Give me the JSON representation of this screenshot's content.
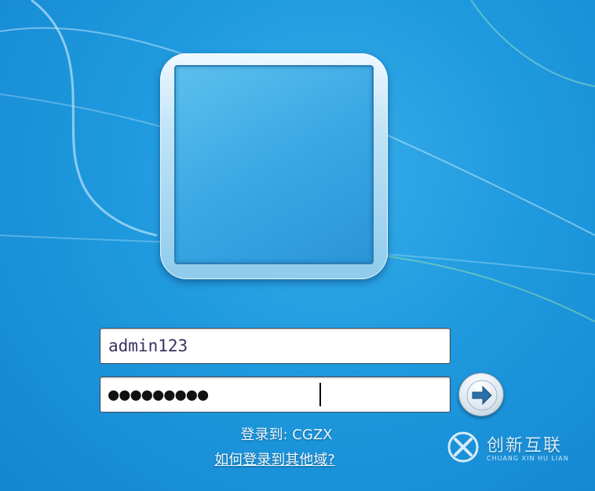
{
  "login": {
    "username_value": "admin123",
    "password_value": "●●●●●●●●●",
    "submit_icon": "arrow-right-icon",
    "domain_text": "登录到: CGZX",
    "other_domain_link": "如何登录到其他域?"
  },
  "watermark": {
    "title": "创新互联",
    "subtitle": "CHUANG XIN HU LIAN"
  },
  "colors": {
    "desktop_bg": "#1f99de",
    "frame": "#bfe3f6",
    "arrow": "#2b6fa8"
  }
}
